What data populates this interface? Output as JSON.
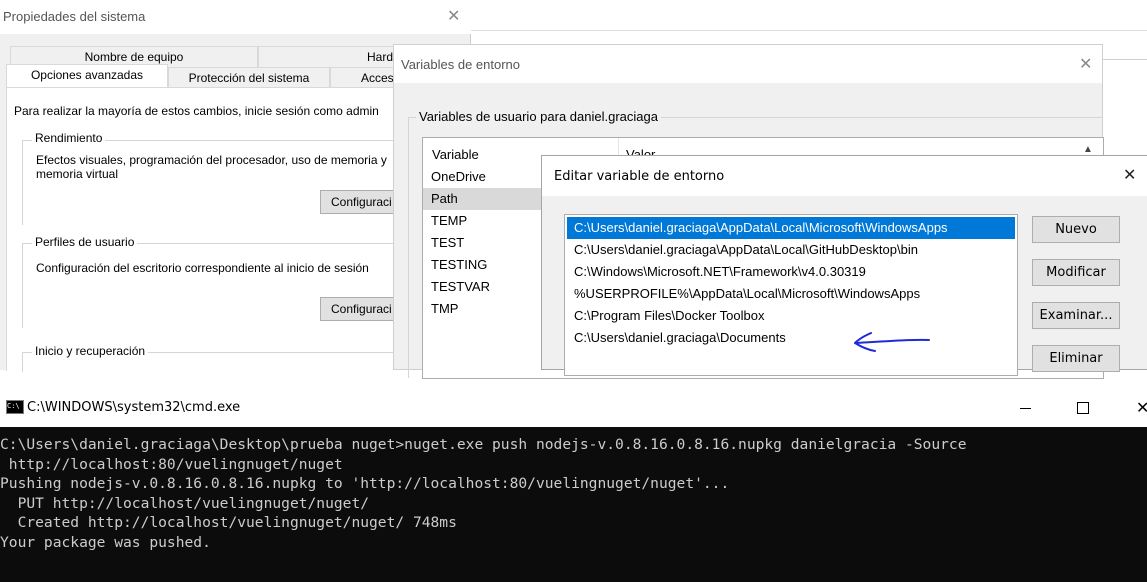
{
  "system_props": {
    "title": "Propiedades del sistema",
    "tabs_row1": [
      "Nombre de equipo",
      "Hardware"
    ],
    "tabs_row2": [
      "Opciones avanzadas",
      "Protección del sistema",
      "Acces"
    ],
    "admin_note": "Para realizar la mayoría de estos cambios, inicie sesión como admin",
    "performance": {
      "label": "Rendimiento",
      "description": "Efectos visuales, programación del procesador, uso de memoria y memoria virtual",
      "button": "Configuraci"
    },
    "profiles": {
      "label": "Perfiles de usuario",
      "description": "Configuración del escritorio correspondiente al inicio de sesión",
      "button": "Configuraci"
    },
    "startup": {
      "label": "Inicio y recuperación"
    }
  },
  "env_vars": {
    "title": "Variables de entorno",
    "user_group_label": "Variables de usuario para daniel.graciaga",
    "columns": [
      "Variable",
      "Valor"
    ],
    "variables": [
      "OneDrive",
      "Path",
      "TEMP",
      "TEST",
      "TESTING",
      "TESTVAR",
      "TMP"
    ],
    "selected": "Path"
  },
  "edit_var": {
    "title": "Editar variable de entorno",
    "entries": [
      "C:\\Users\\daniel.graciaga\\AppData\\Local\\Microsoft\\WindowsApps",
      "C:\\Users\\daniel.graciaga\\AppData\\Local\\GitHubDesktop\\bin",
      "C:\\Windows\\Microsoft.NET\\Framework\\v4.0.30319",
      "%USERPROFILE%\\AppData\\Local\\Microsoft\\WindowsApps",
      "C:\\Program Files\\Docker Toolbox",
      "C:\\Users\\daniel.graciaga\\Documents"
    ],
    "selected_index": 0,
    "buttons": {
      "new": "Nuevo",
      "edit": "Modificar",
      "browse": "Examinar...",
      "delete": "Eliminar"
    },
    "selection_color": "#0078d7"
  },
  "cmd": {
    "title": "C:\\WINDOWS\\system32\\cmd.exe",
    "icon_text": "C:\\",
    "lines": [
      "C:\\Users\\daniel.graciaga\\Desktop\\prueba nuget>nuget.exe push nodejs-v.0.8.16.0.8.16.nupkg danielgracia -Source",
      " http://localhost:80/vuelingnuget/nuget",
      "Pushing nodejs-v.0.8.16.0.8.16.nupkg to 'http://localhost:80/vuelingnuget/nuget'...",
      "  PUT http://localhost/vuelingnuget/nuget/",
      "  Created http://localhost/vuelingnuget/nuget/ 748ms",
      "Your package was pushed."
    ],
    "background": "#0c0c0c",
    "text_color": "#cccccc"
  }
}
